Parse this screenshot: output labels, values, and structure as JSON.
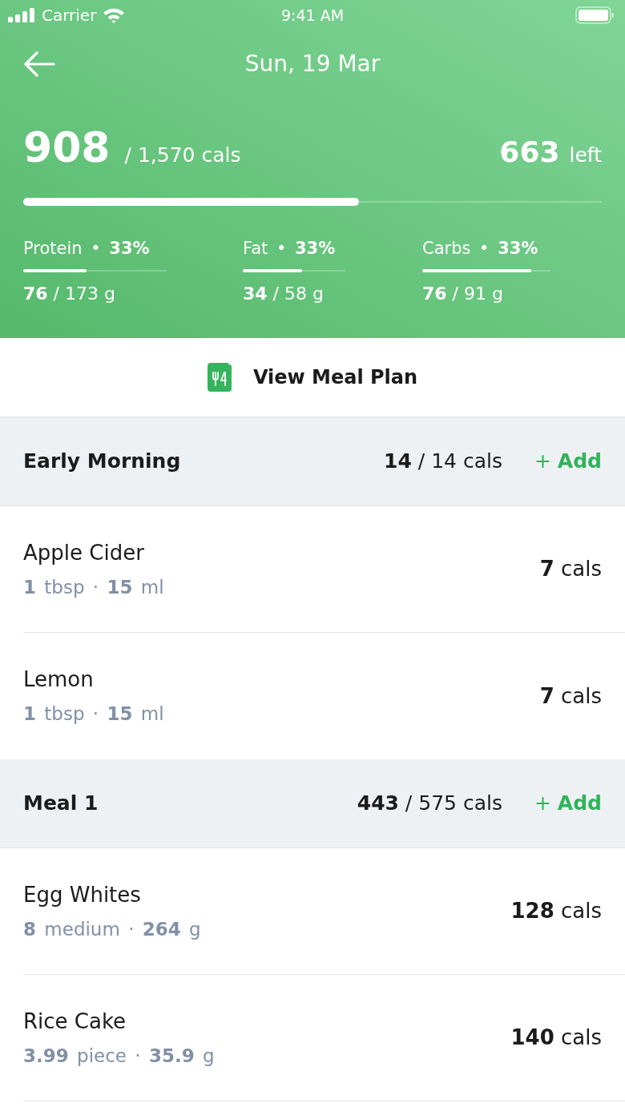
{
  "status_bar": {
    "carrier": "Carrier",
    "time": "9:41 AM"
  },
  "header": {
    "title": "Sun, 19 Mar",
    "consumed": "908",
    "target": "/ 1,570 cals",
    "remaining": "663",
    "remaining_label": "left",
    "level": 0.58
  },
  "macros": [
    {
      "label": "Protein • **33%**",
      "amount": "**76** / 173 g",
      "level": 0.44
    },
    {
      "label": "Fat • **33%**",
      "amount": "**34** / 58 g",
      "level": 0.58
    },
    {
      "label": "Carbs • **33%**",
      "amount": "**76** / 91 g",
      "level": 0.85
    }
  ],
  "meal_plan_button": {
    "label": "View Meal Plan"
  },
  "meals": [
    {
      "name": "Early Morning",
      "calories": "**14** / 14 cals",
      "add_label": "+ **Add**",
      "items": [
        {
          "name": "Apple Cider",
          "portion": "**1** tbsp · **15** ml",
          "calories": "**7** cals"
        },
        {
          "name": "Lemon",
          "portion": "**1** tbsp · **15** ml",
          "calories": "**7** cals"
        }
      ]
    },
    {
      "name": "Meal 1",
      "calories": "**443** / 575 cals",
      "add_label": "+ **Add**",
      "items": [
        {
          "name": "Egg Whites",
          "portion": "**8** medium · **264** g",
          "calories": "**128** cals"
        },
        {
          "name": "Rice Cake",
          "portion": "**3.99** piece · **35.9** g",
          "calories": "**140** cals"
        }
      ]
    }
  ]
}
